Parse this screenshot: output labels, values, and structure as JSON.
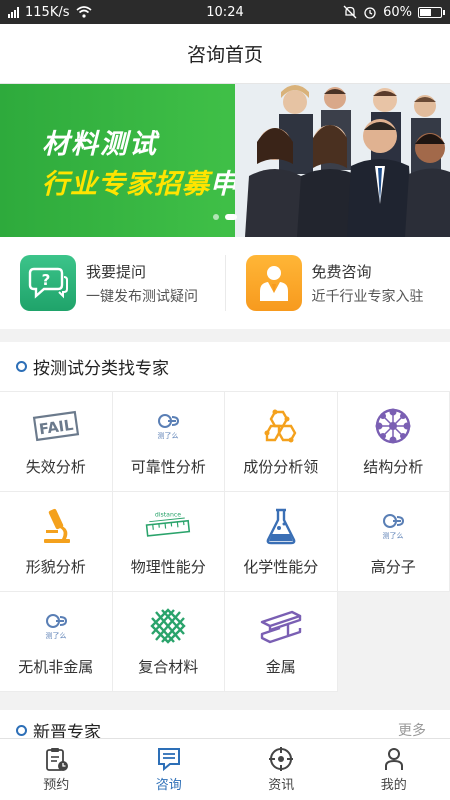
{
  "status": {
    "network_speed": "115K/s",
    "time": "10:24",
    "battery": "60%",
    "battery_level": 0.6
  },
  "header": {
    "title": "咨询首页"
  },
  "banner": {
    "line1": "材料测试",
    "line2_highlight": "行业专家招募",
    "line2_rest": "申请中",
    "slide_count": 2,
    "active_slide": 1
  },
  "quick_actions": [
    {
      "title": "我要提问",
      "subtitle": "一键发布测试疑问",
      "icon": "question-chat-icon"
    },
    {
      "title": "免费咨询",
      "subtitle": "近千行业专家入驻",
      "icon": "expert-person-icon"
    }
  ],
  "categories_section": {
    "title": "按测试分类找专家"
  },
  "categories": [
    {
      "label": "失效分析",
      "icon": "fail-stamp-icon"
    },
    {
      "label": "可靠性分析",
      "icon": "cele-logo-icon"
    },
    {
      "label": "成份分析领",
      "icon": "molecule-icon"
    },
    {
      "label": "结构分析",
      "icon": "crystal-structure-icon"
    },
    {
      "label": "形貌分析",
      "icon": "microscope-icon"
    },
    {
      "label": "物理性能分",
      "icon": "distance-ruler-icon"
    },
    {
      "label": "化学性能分",
      "icon": "flask-icon"
    },
    {
      "label": "高分子",
      "icon": "cele-logo-icon"
    },
    {
      "label": "无机非金属",
      "icon": "cele-logo-icon"
    },
    {
      "label": "复合材料",
      "icon": "composite-weave-icon"
    },
    {
      "label": "金属",
      "icon": "metal-beam-icon"
    }
  ],
  "logo_text": "测了么",
  "distance_text": "distance",
  "experts_section": {
    "title": "新晋专家",
    "more": "更多"
  },
  "tabs": [
    {
      "label": "预约",
      "icon": "clipboard-icon",
      "active": false
    },
    {
      "label": "咨询",
      "icon": "chat-doc-icon",
      "active": true
    },
    {
      "label": "资讯",
      "icon": "target-icon",
      "active": false
    },
    {
      "label": "我的",
      "icon": "user-icon",
      "active": false
    }
  ],
  "colors": {
    "accent": "#2d6fb7",
    "banner_green": "#3fbf47",
    "banner_yellow": "#ffe400",
    "orange_icon": "#f4a11d",
    "purple_icon": "#7a5fb3",
    "green_icon": "#2aa36b"
  }
}
